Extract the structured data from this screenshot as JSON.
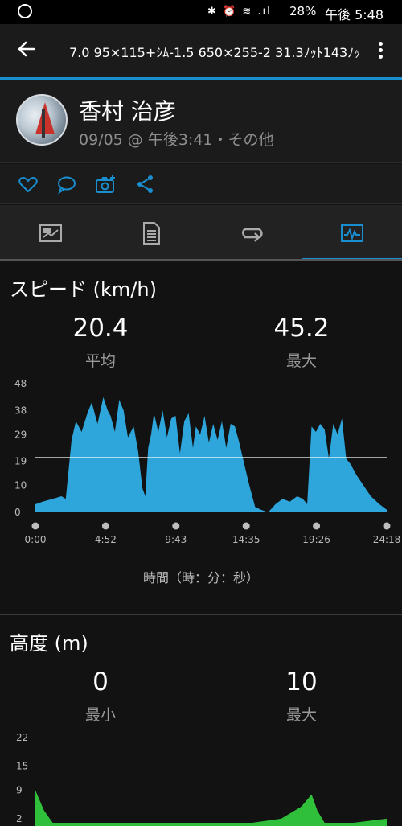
{
  "status_bar": {
    "icons": "✱ ⏰ ≋ .ıl",
    "battery": "28%",
    "time": "午後 5:48"
  },
  "app_bar": {
    "title": "7.0 95×115+ｼﾑ-1.5 650×255-2 31.3ﾉｯﾄ143ﾉｯﾄ"
  },
  "profile": {
    "name": "香村 治彦",
    "meta": "09/05 @ 午後3:41・その他"
  },
  "actions": [
    "heart-icon",
    "comment-icon",
    "camera-add-icon",
    "share-icon"
  ],
  "tabs": [
    {
      "icon": "summary-flag-icon",
      "active": false
    },
    {
      "icon": "details-list-icon",
      "active": false
    },
    {
      "icon": "laps-loop-icon",
      "active": false
    },
    {
      "icon": "charts-icon",
      "active": true
    }
  ],
  "speed": {
    "title": "スピード (km/h)",
    "avg_value": "20.4",
    "avg_label": "平均",
    "max_value": "45.2",
    "max_label": "最大",
    "xlabel": "時間（時：分：秒）"
  },
  "elevation": {
    "title": "高度 (m)",
    "min_value": "0",
    "min_label": "最小",
    "max_value": "10",
    "max_label": "最大"
  },
  "colors": {
    "accent": "#1a8fd0",
    "speed_fill": "#2ea6dc",
    "elevation_fill": "#2fbf3a",
    "average_line": "#ffffff"
  },
  "chart_data": [
    {
      "type": "area",
      "title": "スピード (km/h)",
      "xlabel": "時間（時：分：秒）",
      "x_ticks": [
        "0:00",
        "4:52",
        "9:43",
        "14:35",
        "19:26",
        "24:18"
      ],
      "y_ticks": [
        0,
        10,
        19,
        29,
        38,
        48
      ],
      "ylim": [
        0,
        48
      ],
      "xlim_minutes": [
        0,
        24.3
      ],
      "reference_line": 20.4,
      "x_minutes": [
        0,
        0.5,
        1.2,
        1.8,
        2.1,
        2.5,
        2.8,
        3.2,
        3.6,
        3.9,
        4.3,
        4.7,
        5.0,
        5.2,
        5.5,
        5.8,
        6.1,
        6.4,
        6.8,
        7.1,
        7.4,
        7.6,
        7.8,
        8.0,
        8.2,
        8.5,
        8.8,
        9.1,
        9.4,
        9.7,
        10.0,
        10.3,
        10.6,
        10.9,
        11.1,
        11.4,
        11.7,
        12.0,
        12.3,
        12.6,
        12.9,
        13.2,
        13.5,
        13.8,
        14.1,
        14.4,
        14.8,
        15.2,
        15.6,
        16.1,
        16.6,
        17.1,
        17.6,
        18.1,
        18.5,
        18.8,
        19.1,
        19.4,
        19.7,
        20.0,
        20.3,
        20.6,
        20.9,
        21.2,
        21.5,
        21.8,
        22.2,
        22.7,
        23.2,
        23.8,
        24.3
      ],
      "values": [
        3,
        4,
        5,
        6,
        5,
        27,
        34,
        30,
        37,
        41,
        33,
        43,
        38,
        36,
        30,
        42,
        38,
        28,
        32,
        23,
        9,
        6,
        24,
        29,
        37,
        30,
        38,
        28,
        35,
        36,
        22,
        34,
        37,
        24,
        32,
        29,
        36,
        26,
        33,
        27,
        34,
        24,
        33,
        32,
        26,
        19,
        10,
        2,
        1,
        0,
        3,
        5,
        4,
        6,
        5,
        3,
        32,
        30,
        33,
        31,
        20,
        33,
        29,
        35,
        20,
        18,
        14,
        10,
        6,
        3,
        1
      ]
    },
    {
      "type": "area",
      "title": "高度 (m)",
      "y_ticks": [
        2,
        9,
        15,
        22
      ],
      "ylim": [
        0,
        22
      ],
      "xlim_minutes": [
        0,
        24.3
      ],
      "x_minutes": [
        0,
        0.6,
        1.2,
        3,
        6,
        9,
        12,
        15,
        17,
        18.4,
        19.1,
        19.5,
        20,
        22,
        24.3
      ],
      "values": [
        9,
        4,
        1,
        1,
        1,
        1,
        1,
        1,
        2,
        5,
        8,
        4,
        1,
        1,
        2
      ]
    }
  ]
}
